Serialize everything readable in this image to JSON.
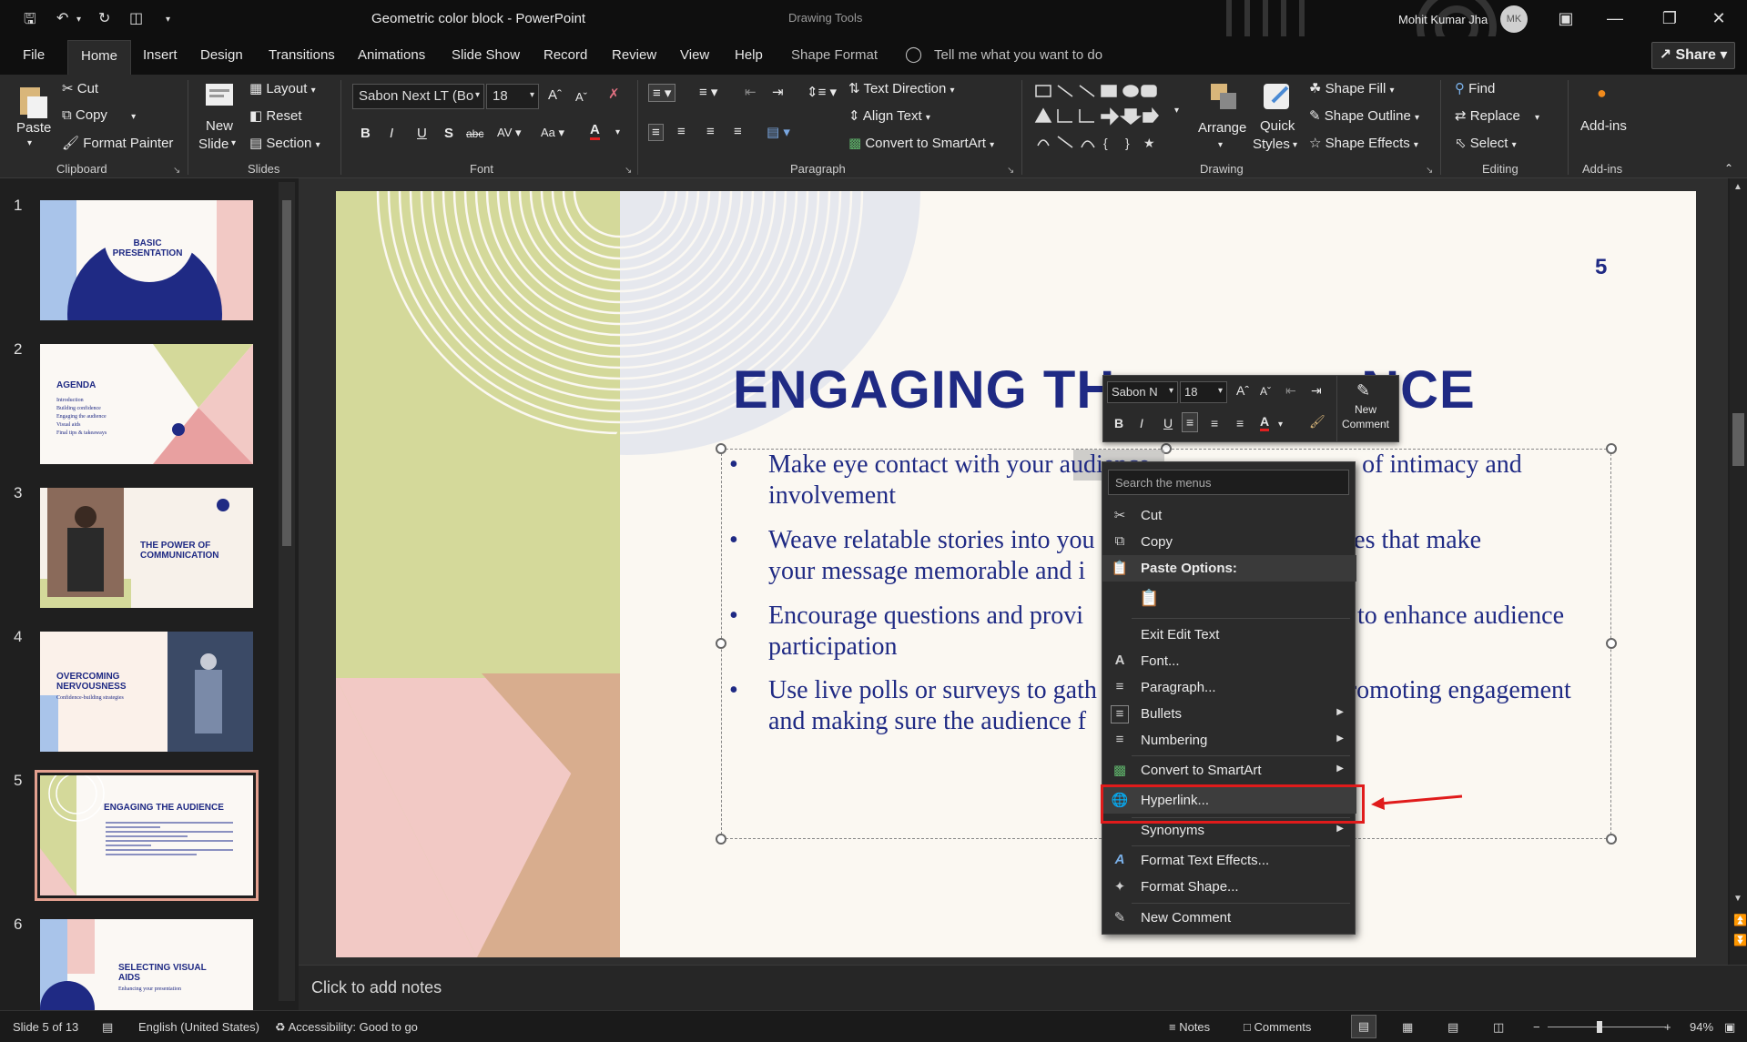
{
  "window": {
    "doc_title": "Geometric color block  -  PowerPoint",
    "context_tab_group": "Drawing Tools",
    "user_name": "Mohit Kumar Jha",
    "user_initials": "MK"
  },
  "tabs": [
    {
      "label": "File"
    },
    {
      "label": "Home"
    },
    {
      "label": "Insert"
    },
    {
      "label": "Design"
    },
    {
      "label": "Transitions"
    },
    {
      "label": "Animations"
    },
    {
      "label": "Slide Show"
    },
    {
      "label": "Record"
    },
    {
      "label": "Review"
    },
    {
      "label": "View"
    },
    {
      "label": "Help"
    },
    {
      "label": "Shape Format"
    }
  ],
  "tell_me": "Tell me what you want to do",
  "share_label": "Share",
  "ribbon": {
    "clipboard": {
      "paste": "Paste",
      "cut": "Cut",
      "copy": "Copy",
      "format_painter": "Format Painter",
      "group": "Clipboard"
    },
    "slides": {
      "new_slide_1": "New",
      "new_slide_2": "Slide",
      "layout": "Layout",
      "reset": "Reset",
      "section": "Section",
      "group": "Slides"
    },
    "font": {
      "font_name": "Sabon Next LT (Bo",
      "font_size": "18",
      "group": "Font"
    },
    "paragraph": {
      "text_direction": "Text Direction",
      "align_text": "Align Text",
      "convert_smartart": "Convert to SmartArt",
      "group": "Paragraph"
    },
    "drawing": {
      "arrange": "Arrange",
      "quick_styles_1": "Quick",
      "quick_styles_2": "Styles",
      "shape_fill": "Shape Fill",
      "shape_outline": "Shape Outline",
      "shape_effects": "Shape Effects",
      "group": "Drawing"
    },
    "editing": {
      "find": "Find",
      "replace": "Replace",
      "select": "Select",
      "group": "Editing"
    },
    "addins": {
      "addins": "Add-ins",
      "group": "Add-ins"
    }
  },
  "thumbnails": [
    {
      "num": "1",
      "title": "BASIC PRESENTATION"
    },
    {
      "num": "2",
      "title": "AGENDA",
      "lines": [
        "Introduction",
        "Building confidence",
        "Engaging the audience",
        "Visual aids",
        "Final tips & takeaways"
      ]
    },
    {
      "num": "3",
      "title": "THE POWER OF COMMUNICATION"
    },
    {
      "num": "4",
      "title": "OVERCOMING NERVOUSNESS",
      "subtitle": "Confidence-building strategies"
    },
    {
      "num": "5",
      "title": "ENGAGING THE AUDIENCE"
    },
    {
      "num": "6",
      "title": "SELECTING VISUAL AIDS",
      "subtitle": "Enhancing your presentation"
    }
  ],
  "slide": {
    "number": "5",
    "title": "ENGAGING THE AUDIENCE",
    "title_visible_left": "ENGAGING TH",
    "title_visible_right": "NCE",
    "bullets": [
      {
        "line1": "Make eye contact with your audience to create a sense of intimacy and",
        "line2": "involvement"
      },
      {
        "line1": "Weave relatable stories into your presentation using narratives that make",
        "line2": "your message memorable and impactful"
      },
      {
        "line1": "Encourage questions and provide thoughtful responses to enhance audience",
        "line2": "participation"
      },
      {
        "line1": "Use live polls or surveys to gather audience opinions, promoting engagement",
        "line2": "and making sure the audience feels heard"
      }
    ],
    "visible": {
      "b1_left": "Make eye contact with your ",
      "b1_sel": "audience",
      "b1_right": " of intimacy and",
      "b1_line2": "involvement",
      "b2_left": "Weave relatable stories into you",
      "b2_right": "rratives that make",
      "b2_line2": "your message memorable and i",
      "b3_left": "Encourage questions and provi",
      "b3_right": " to enhance audience",
      "b3_line2": "participation",
      "b4_left": "Use live polls or surveys to gath",
      "b4_right": "romoting engagement",
      "b4_line2": "and making sure the audience f"
    }
  },
  "mini_toolbar": {
    "font": "Sabon N",
    "size": "18",
    "new_comment_1": "New",
    "new_comment_2": "Comment"
  },
  "context_menu": {
    "search_placeholder": "Search the menus",
    "items": {
      "cut": "Cut",
      "copy": "Copy",
      "paste_options": "Paste Options:",
      "exit_edit_text": "Exit Edit Text",
      "font": "Font...",
      "paragraph": "Paragraph...",
      "bullets": "Bullets",
      "numbering": "Numbering",
      "convert_smartart": "Convert to SmartArt",
      "hyperlink": "Hyperlink...",
      "synonyms": "Synonyms",
      "format_text_effects": "Format Text Effects...",
      "format_shape": "Format Shape...",
      "new_comment": "New Comment"
    },
    "highlighted_item": "Hyperlink..."
  },
  "notes_placeholder": "Click to add notes",
  "status": {
    "slide_info": "Slide 5 of 13",
    "language": "English (United States)",
    "accessibility": "Accessibility: Good to go",
    "notes": "Notes",
    "comments": "Comments",
    "zoom": "94%"
  },
  "colors": {
    "slide_blue": "#1f2a84",
    "annotation_red": "#e01b1b",
    "green_block": "#d4d99a",
    "pink_block": "#f2c9c5",
    "tan_block": "#d8ad8e"
  }
}
